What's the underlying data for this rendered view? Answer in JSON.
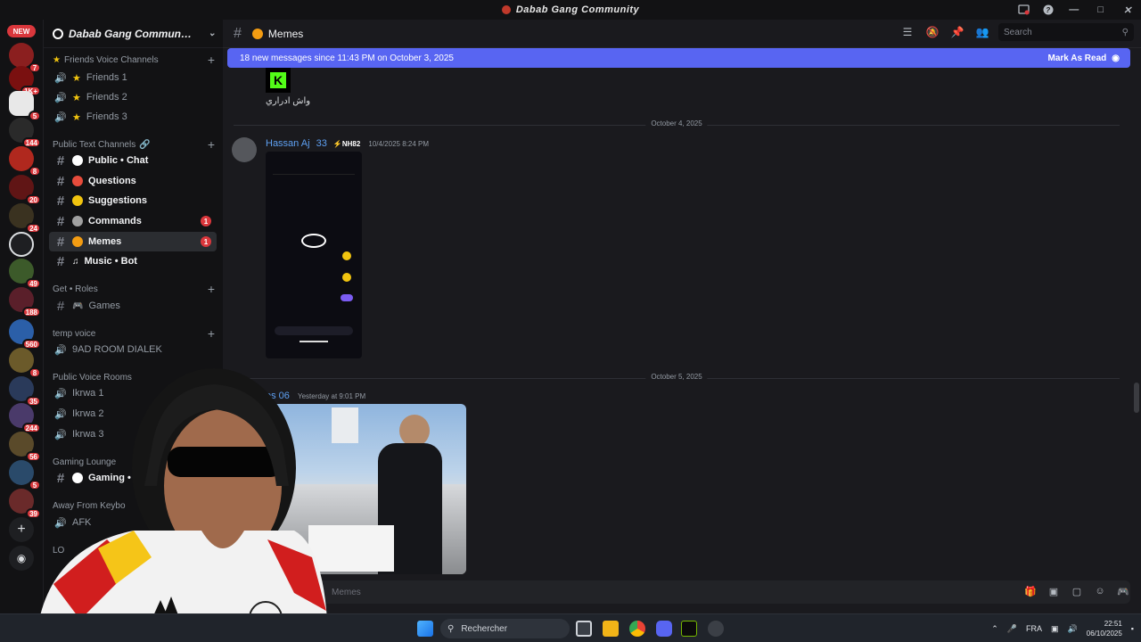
{
  "window": {
    "title": "Dabab Gang Community"
  },
  "rail": {
    "new_label": "NEW",
    "badges": [
      "7",
      "1K+",
      "5",
      "144",
      "8",
      "20",
      "24",
      "49",
      "188",
      "560",
      "8",
      "35",
      "244",
      "56",
      "5",
      "39"
    ]
  },
  "sidebar": {
    "guild_name": "Dabab Gang Commun…",
    "categories": [
      {
        "label": "Friends Voice Channels"
      },
      {
        "label": "Public Text Channels"
      },
      {
        "label": "Get • Roles"
      },
      {
        "label": "temp voice"
      },
      {
        "label": "Public Voice Rooms"
      },
      {
        "label": "Gaming Lounge"
      },
      {
        "label": "Away From Keybo"
      },
      {
        "label": "LO"
      }
    ],
    "channels": [
      {
        "label": "Friends 1"
      },
      {
        "label": "Friends 2"
      },
      {
        "label": "Friends 3"
      },
      {
        "label": "Public • Chat"
      },
      {
        "label": "Questions"
      },
      {
        "label": "Suggestions"
      },
      {
        "label": "Commands",
        "unread": "1"
      },
      {
        "label": "Memes",
        "unread": "1"
      },
      {
        "label": "Music • Bot"
      },
      {
        "label": "Games"
      },
      {
        "label": "9AD ROOM DIALEK"
      },
      {
        "label": "Ikrwa 1"
      },
      {
        "label": "Ikrwa 2"
      },
      {
        "label": "Ikrwa 3"
      },
      {
        "label": "Gaming • Cha"
      },
      {
        "label": "AFK"
      }
    ]
  },
  "header": {
    "channel_name": "Memes",
    "search_placeholder": "Search"
  },
  "banner": {
    "text": "18 new messages since 11:43 PM on October 3, 2025",
    "mark_as_read": "Mark As Read"
  },
  "messages": {
    "first_caption": "واش ادراري",
    "divider1": "October 4, 2025",
    "msg1_author": "Hassan Aj",
    "msg1_num": "33",
    "msg1_tag": "NH82",
    "msg1_time": "10/4/2025 8:24 PM",
    "divider2": "October 5, 2025",
    "msg2_author": "es 06",
    "msg2_time": "Yesterday at 9:01 PM"
  },
  "composer": {
    "placeholder": "Memes"
  },
  "taskbar": {
    "search": "Rechercher",
    "lang": "FRA",
    "time": "22:51",
    "date": "06/10/2025"
  },
  "colors": {
    "accent": "#5865f2",
    "badge": "#da373c",
    "author": "#5ea0f2",
    "bg": "#1a1a1e"
  }
}
